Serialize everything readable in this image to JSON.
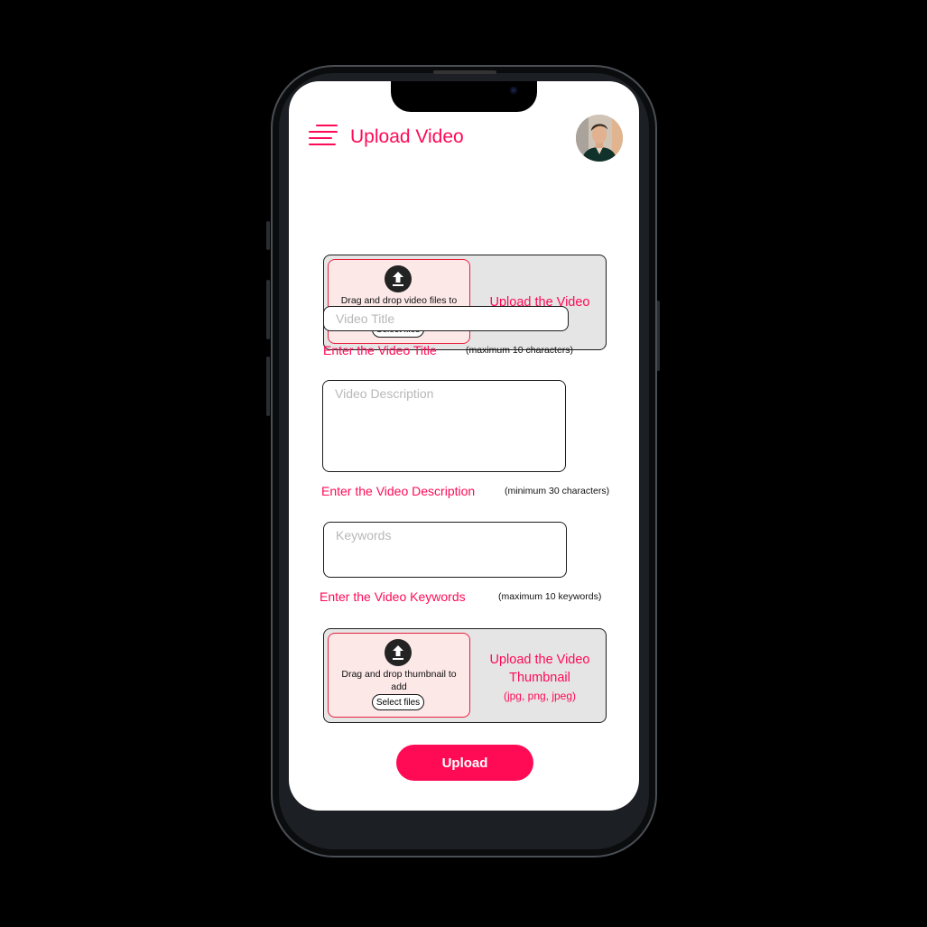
{
  "header": {
    "title": "Upload Video",
    "menu_icon": "hamburger-menu-icon",
    "avatar_icon": "user-avatar"
  },
  "video_upload": {
    "icon": "upload-arrow-icon",
    "drop_text": "Drag and drop video files to upload",
    "select_button": "Select files",
    "label": "Upload the Video"
  },
  "title_field": {
    "placeholder": "Video Title",
    "value": "",
    "label": "Enter the Video Title",
    "hint": "(maximum 10 characters)"
  },
  "description_field": {
    "placeholder": "Video Description",
    "value": "",
    "label": "Enter the Video Description",
    "hint": "(minimum 30 characters)"
  },
  "keywords_field": {
    "placeholder": "Keywords",
    "value": "",
    "label": "Enter the Video Keywords",
    "hint": "(maximum 10 keywords)"
  },
  "thumbnail_upload": {
    "icon": "upload-arrow-icon",
    "drop_text": "Drag and drop thumbnail to add",
    "select_button": "Select files",
    "label": "Upload the Video Thumbnail",
    "formats": "(jpg, png, jpeg)"
  },
  "submit": {
    "label": "Upload"
  },
  "colors": {
    "accent": "#ff0a55",
    "panel_bg": "#e5e5e5",
    "dropzone_bg": "#fde8e8",
    "dropzone_border": "#e8203c"
  }
}
